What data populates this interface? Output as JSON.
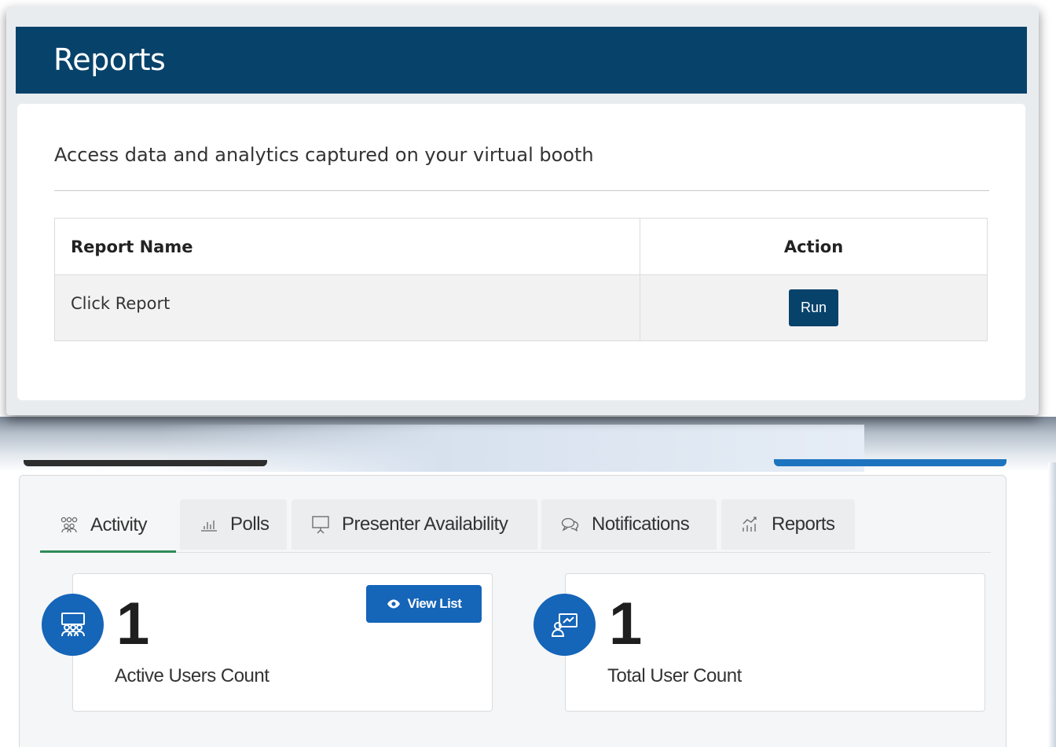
{
  "reports_panel": {
    "title": "Reports",
    "description": "Access data and analytics captured on your virtual booth",
    "table": {
      "headers": [
        "Report Name",
        "Action"
      ],
      "rows": [
        {
          "name": "Click Report",
          "action_label": "Run"
        }
      ]
    }
  },
  "dashboard": {
    "tabs": [
      {
        "label": "Activity",
        "icon": "users-group-icon",
        "active": true
      },
      {
        "label": "Polls",
        "icon": "bar-chart-icon",
        "active": false
      },
      {
        "label": "Presenter Availability",
        "icon": "presentation-board-icon",
        "active": false
      },
      {
        "label": "Notifications",
        "icon": "chat-bubbles-icon",
        "active": false
      },
      {
        "label": "Reports",
        "icon": "analytics-icon",
        "active": false
      }
    ],
    "cards": [
      {
        "value": "1",
        "label": "Active Users Count",
        "icon": "audience-icon",
        "button_label": "View List",
        "button_icon": "eye-icon"
      },
      {
        "value": "1",
        "label": "Total User Count",
        "icon": "presenter-screen-icon"
      }
    ]
  },
  "colors": {
    "header_blue": "#07426b",
    "accent_blue": "#1565b8",
    "active_tab_underline": "#2e8b57"
  }
}
